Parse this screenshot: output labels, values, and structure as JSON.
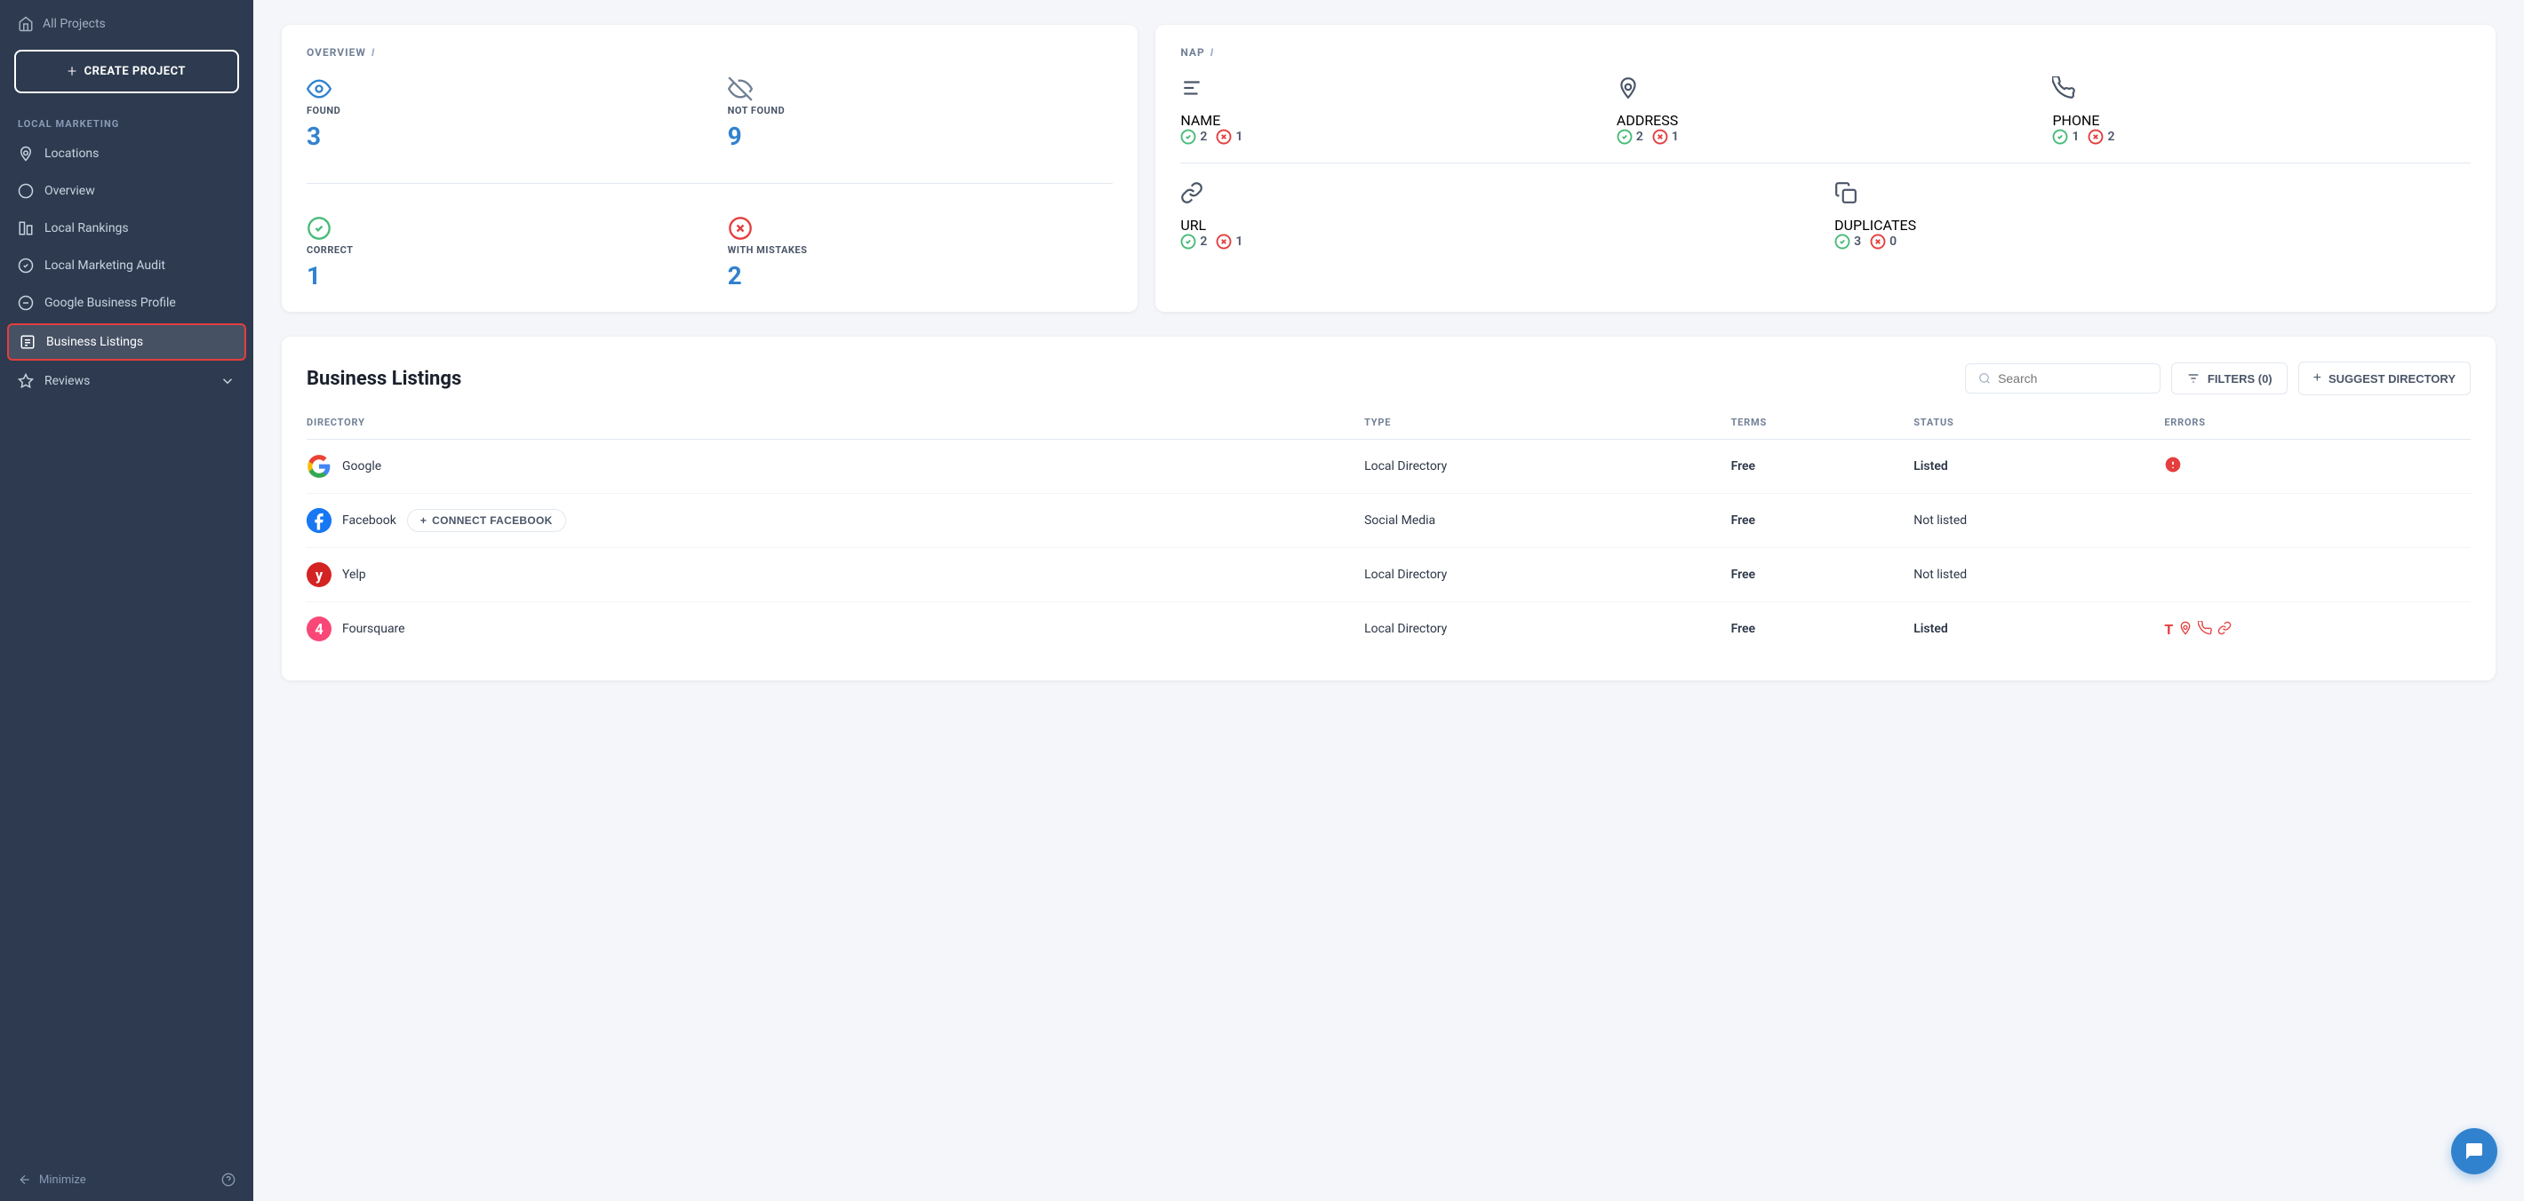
{
  "sidebar": {
    "all_projects_label": "All Projects",
    "create_button_label": "CREATE PROJECT",
    "section_label": "LOCAL MARKETING",
    "items": [
      {
        "id": "locations",
        "label": "Locations",
        "icon": "location"
      },
      {
        "id": "overview",
        "label": "Overview",
        "icon": "circle"
      },
      {
        "id": "local-rankings",
        "label": "Local Rankings",
        "icon": "chart"
      },
      {
        "id": "local-marketing-audit",
        "label": "Local Marketing Audit",
        "icon": "circle-check"
      },
      {
        "id": "google-business-profile",
        "label": "Google Business Profile",
        "icon": "g"
      },
      {
        "id": "business-listings",
        "label": "Business Listings",
        "icon": "list",
        "active": true
      },
      {
        "id": "reviews",
        "label": "Reviews",
        "icon": "star",
        "has_chevron": true
      }
    ],
    "minimize_label": "Minimize"
  },
  "overview_card": {
    "title": "OVERVIEW",
    "info": "i",
    "found_label": "FOUND",
    "found_value": "3",
    "not_found_label": "NOT FOUND",
    "not_found_value": "9",
    "correct_label": "CORRECT",
    "correct_value": "1",
    "with_mistakes_label": "WITH MISTAKES",
    "with_mistakes_value": "2"
  },
  "nap_card": {
    "title": "NAP",
    "info": "i",
    "name_label": "NAME",
    "name_correct": "2",
    "name_errors": "1",
    "address_label": "ADDRESS",
    "address_correct": "2",
    "address_errors": "1",
    "phone_label": "PHONE",
    "phone_correct": "1",
    "phone_errors": "2",
    "url_label": "URL",
    "url_correct": "2",
    "url_errors": "1",
    "duplicates_label": "DUPLICATES",
    "duplicates_correct": "3",
    "duplicates_errors": "0"
  },
  "business_listings": {
    "title": "Business Listings",
    "search_placeholder": "Search",
    "filters_label": "FILTERS (0)",
    "suggest_label": "SUGGEST DIRECTORY",
    "columns": {
      "directory": "DIRECTORY",
      "type": "TYPE",
      "terms": "TERMS",
      "status": "STATUS",
      "errors": "ERRORS"
    },
    "rows": [
      {
        "name": "Google",
        "icon_type": "google",
        "type": "Local Directory",
        "terms": "Free",
        "status": "Listed",
        "status_type": "listed",
        "has_error": true,
        "error_icons": [
          "circle-exclamation"
        ]
      },
      {
        "name": "Facebook",
        "icon_type": "facebook",
        "type": "Social Media",
        "terms": "Free",
        "status": "Not listed",
        "status_type": "not-listed",
        "connect_button": "CONNECT FACEBOOK",
        "has_error": false,
        "error_icons": []
      },
      {
        "name": "Yelp",
        "icon_type": "yelp",
        "type": "Local Directory",
        "terms": "Free",
        "status": "Not listed",
        "status_type": "not-listed",
        "has_error": false,
        "error_icons": []
      },
      {
        "name": "Foursquare",
        "icon_type": "foursquare",
        "type": "Local Directory",
        "terms": "Free",
        "status": "Listed",
        "status_type": "listed",
        "has_error": true,
        "error_icons": [
          "T",
          "location",
          "phone",
          "link"
        ]
      }
    ]
  },
  "colors": {
    "blue": "#3182ce",
    "green": "#48bb78",
    "red": "#e53e3e",
    "sidebar_bg": "#2d3a4f"
  }
}
